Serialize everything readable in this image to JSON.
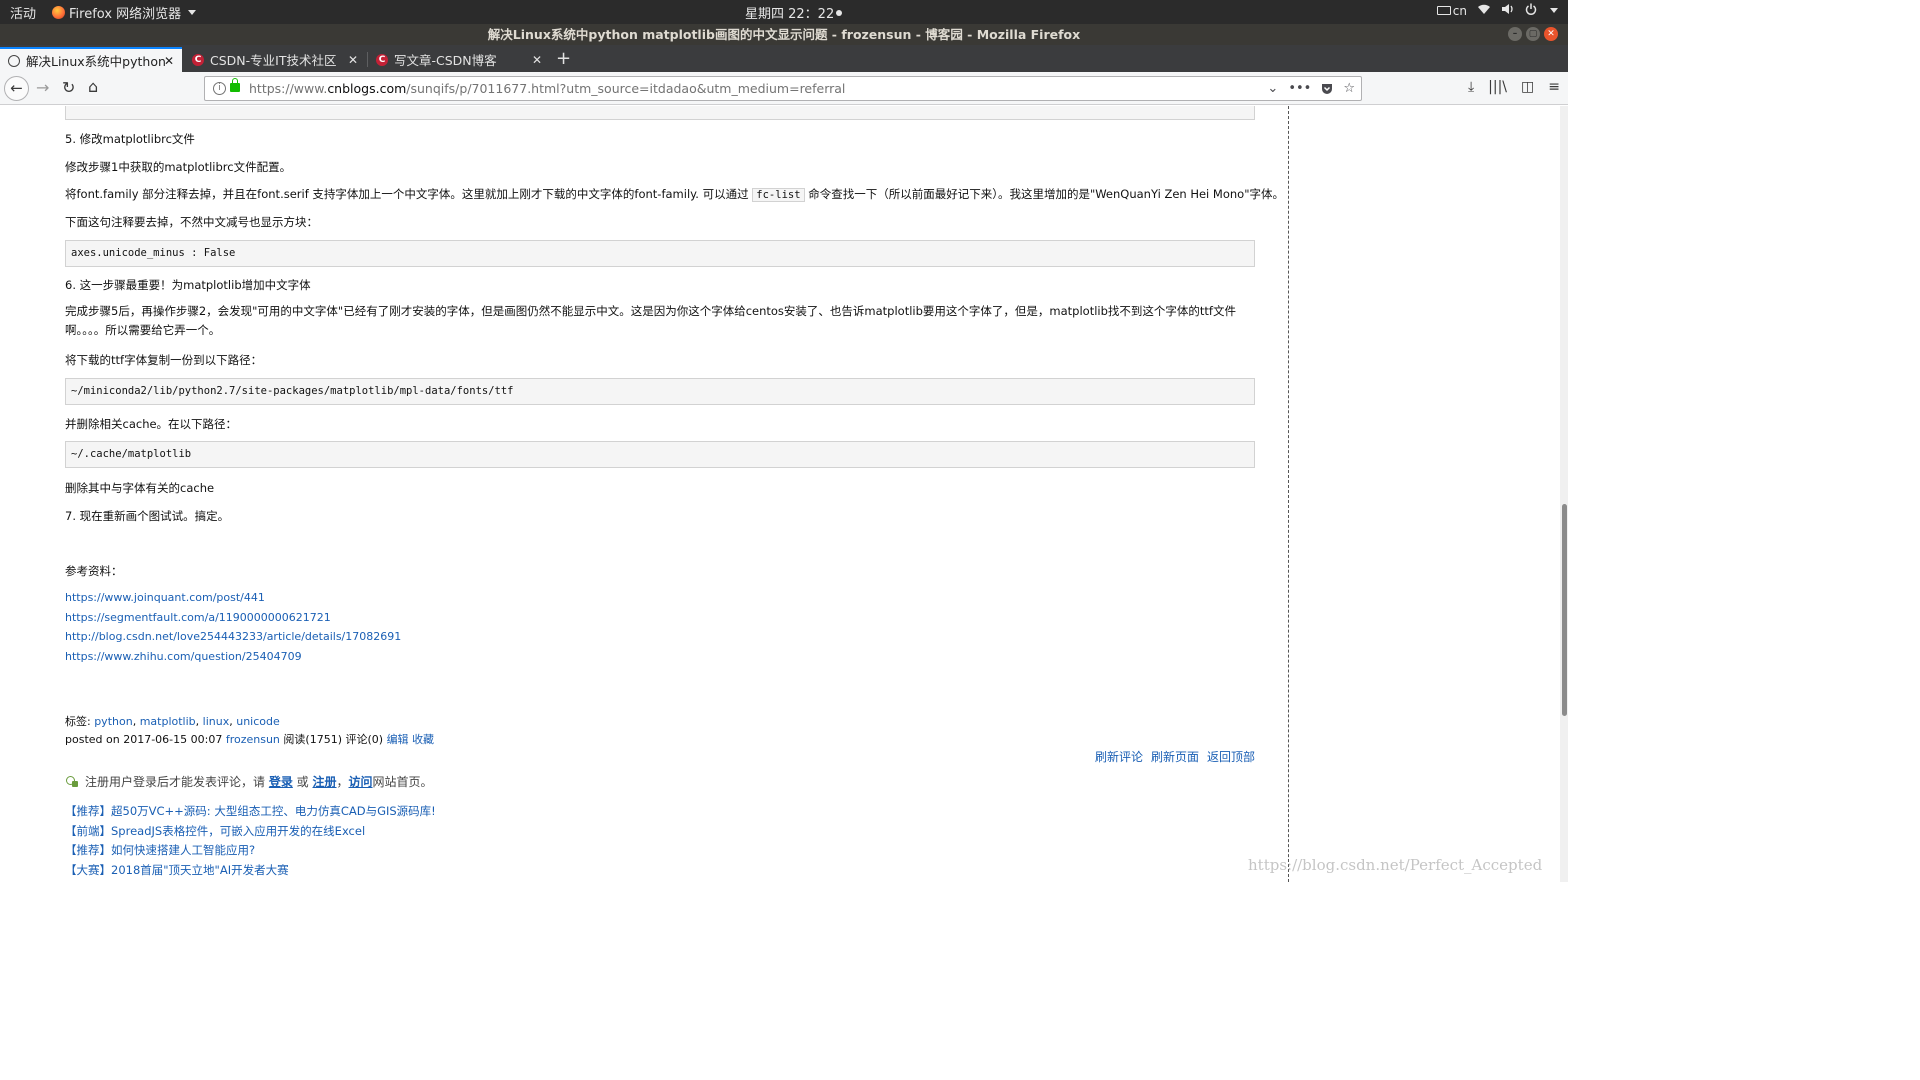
{
  "system_bar": {
    "activities": "活动",
    "app_name": "Firefox 网络浏览器",
    "clock": "星期四 22：22",
    "input_method": "cn"
  },
  "window": {
    "title": "解决Linux系统中python matplotlib画图的中文显示问题 - frozensun - 博客园 - Mozilla Firefox"
  },
  "tabs": [
    {
      "label": "解决Linux系统中python",
      "favicon": "cnblogs-icon",
      "close": "✕"
    },
    {
      "label": "CSDN-专业IT技术社区",
      "favicon": "csdn-icon",
      "close": "✕"
    },
    {
      "label": "写文章-CSDN博客",
      "favicon": "csdn-icon",
      "close": "✕"
    }
  ],
  "new_tab": "+",
  "nav": {
    "url_prefix": "https://www.",
    "url_host": "cnblogs.com",
    "url_rest": "/sunqifs/p/7011677.html?utm_source=itdadao&utm_medium=referral"
  },
  "article": {
    "step5_title": "5. 修改matplotlibrc文件",
    "step5_p1": "修改步骤1中获取的matplotlibrc文件配置。",
    "step5_p2_before": "将font.family 部分注释去掉，并且在font.serif 支持字体加上一个中文字体。这里就加上刚才下载的中文字体的font-family. 可以通过 ",
    "step5_p2_code": "fc-list",
    "step5_p2_after": " 命令查找一下（所以前面最好记下来）。我这里增加的是\"WenQuanYi Zen Hei Mono\"字体。",
    "step5_p3": "下面这句注释要去掉，不然中文减号也显示方块：",
    "code1": "axes.unicode_minus  : False",
    "step6_title": "6. 这一步骤最重要！为matplotlib增加中文字体",
    "step6_p1": "完成步骤5后，再操作步骤2，会发现\"可用的中文字体\"已经有了刚才安装的字体，但是画图仍然不能显示中文。这是因为你这个字体给centos安装了、也告诉matplotlib要用这个字体了，但是，matplotlib找不到这个字体的ttf文件啊。。。。所以需要给它弄一个。",
    "step6_p2": "将下载的ttf字体复制一份到以下路径：",
    "code2": "~/miniconda2/lib/python2.7/site-packages/matplotlib/mpl-data/fonts/ttf",
    "step6_p3": "并删除相关cache。在以下路径：",
    "code3": "~/.cache/matplotlib",
    "step6_p4": "删除其中与字体有关的cache",
    "step7": "7. 现在重新画个图试试。搞定。",
    "refs_title": "参考资料：",
    "refs": [
      "https://www.joinquant.com/post/441",
      "https://segmentfault.com/a/1190000000621721",
      "http://blog.csdn.net/love254443233/article/details/17082691",
      "https://www.zhihu.com/question/25404709"
    ]
  },
  "post_meta": {
    "tags_label": "标签: ",
    "tags": [
      "python",
      "matplotlib",
      "linux",
      "unicode"
    ],
    "posted_prefix": "posted on 2017-06-15 00:07 ",
    "author": "frozensun",
    "stats": " 阅读(1751) 评论(0) ",
    "edit": "编辑",
    "favorite": "收藏"
  },
  "comment_links": {
    "refresh_comments": "刷新评论",
    "refresh_page": "刷新页面",
    "back_to_top": "返回顶部"
  },
  "login_tip": {
    "before": "注册用户登录后才能发表评论，请 ",
    "login": "登录",
    "or": " 或 ",
    "register": "注册",
    "comma": "，",
    "visit": "访问",
    "after": "网站首页。"
  },
  "promos": [
    {
      "tag": "【推荐】",
      "text": "超50万VC++源码: 大型组态工控、电力仿真CAD与GIS源码库!"
    },
    {
      "tag": "【前端】",
      "text": "SpreadJS表格控件，可嵌入应用开发的在线Excel"
    },
    {
      "tag": "【推荐】",
      "text": "如何快速搭建人工智能应用?"
    },
    {
      "tag": "【大赛】",
      "text": "2018首届\"顶天立地\"AI开发者大赛"
    }
  ],
  "watermark": "https://blog.csdn.net/Perfect_Accepted",
  "colors": {
    "link": "#1a5fb4",
    "tab_accent": "#0a84ff",
    "csdn_red": "#c32136",
    "lock_green": "#12bc00"
  }
}
